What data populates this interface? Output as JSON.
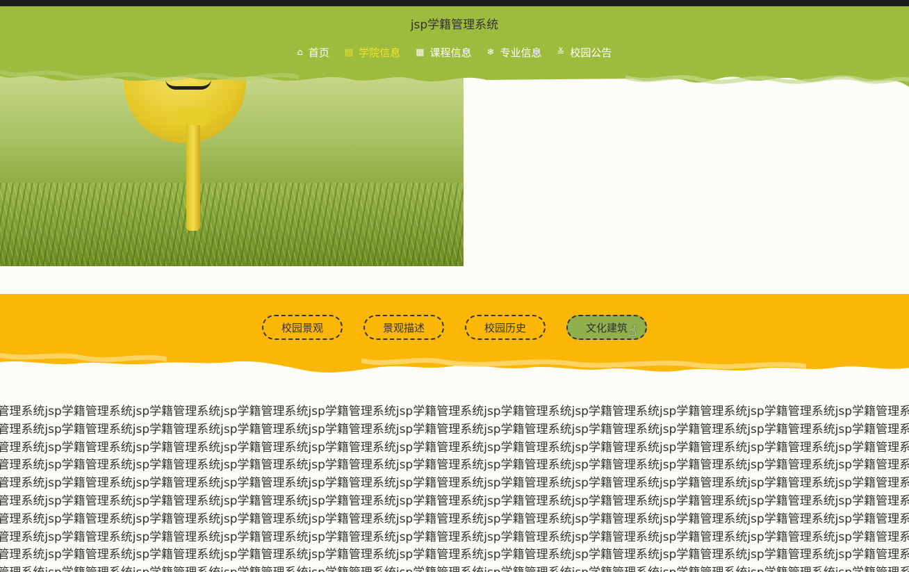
{
  "header": {
    "title": "jsp学籍管理系统",
    "nav": [
      {
        "label": "首页",
        "icon": "home-icon",
        "active": false
      },
      {
        "label": "学院信息",
        "icon": "document-icon",
        "active": true
      },
      {
        "label": "课程信息",
        "icon": "grid-icon",
        "active": false
      },
      {
        "label": "专业信息",
        "icon": "snowflake-icon",
        "active": false
      },
      {
        "label": "校园公告",
        "icon": "sliders-icon",
        "active": false
      }
    ]
  },
  "tabs": [
    {
      "label": "校园景观",
      "active": false
    },
    {
      "label": "景观描述",
      "active": false
    },
    {
      "label": "校园历史",
      "active": false
    },
    {
      "label": "文化建筑",
      "active": true
    }
  ],
  "content": {
    "repeated_text": "jsp学籍管理系统"
  },
  "colors": {
    "header_green": "#9dbb3d",
    "nav_active": "#f3e526",
    "orange_band": "#fbb707",
    "tab_active": "#8fb04a"
  }
}
